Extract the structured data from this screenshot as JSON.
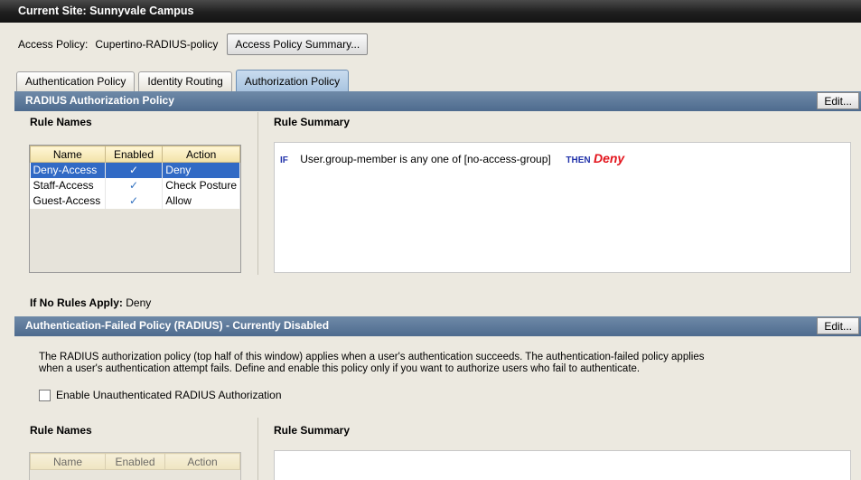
{
  "window": {
    "title": "Current Site:  Sunnyvale Campus"
  },
  "policy": {
    "label": "Access Policy:",
    "value": "Cupertino-RADIUS-policy",
    "summary_button": "Access Policy Summary..."
  },
  "tabs": [
    {
      "label": "Authentication Policy",
      "active": false
    },
    {
      "label": "Identity Routing",
      "active": false
    },
    {
      "label": "Authorization Policy",
      "active": true
    }
  ],
  "radius_section": {
    "title": "RADIUS Authorization Policy",
    "edit_label": "Edit...",
    "rule_names_title": "Rule Names",
    "rule_summary_title": "Rule Summary",
    "columns": [
      "Name",
      "Enabled",
      "Action"
    ],
    "rows": [
      {
        "name": "Deny-Access",
        "enabled": "✓",
        "action": "Deny",
        "selected": true
      },
      {
        "name": "Staff-Access",
        "enabled": "✓",
        "action": "Check Posture",
        "selected": false
      },
      {
        "name": "Guest-Access",
        "enabled": "✓",
        "action": "Allow",
        "selected": false
      }
    ],
    "summary": {
      "if_kw": "IF",
      "condition": "User.group-member is any one of [no-access-group]",
      "then_kw": "THEN",
      "result": "Deny"
    },
    "no_rules_label": "If No Rules Apply:",
    "no_rules_value": "Deny"
  },
  "failed_section": {
    "title": "Authentication-Failed Policy (RADIUS) - Currently Disabled",
    "edit_label": "Edit...",
    "description_line1": "The RADIUS authorization policy (top half of this window) applies when a user's authentication succeeds.  The authentication-failed policy applies",
    "description_line2": "when a user's authentication attempt fails.  Define and enable this policy only if you want to authorize users who fail to authenticate.",
    "checkbox_label": "Enable Unauthenticated RADIUS Authorization",
    "checkbox_checked": false,
    "rule_names_title": "Rule Names",
    "rule_summary_title": "Rule Summary",
    "columns": [
      "Name",
      "Enabled",
      "Action"
    ]
  }
}
